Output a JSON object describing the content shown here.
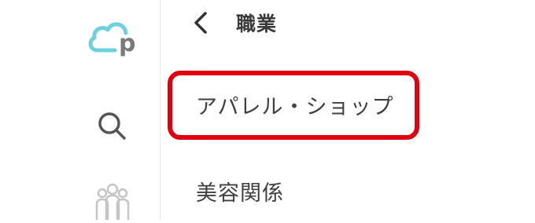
{
  "sidebar": {
    "logo_icon": "cloud-p-logo",
    "logo_letter": "p",
    "icons": [
      "search-icon",
      "people-icon"
    ]
  },
  "header": {
    "back_icon": "chevron-left-icon",
    "title": "職業"
  },
  "list": {
    "items": [
      {
        "label": "アパレル・ショップ"
      },
      {
        "label": "美容関係"
      }
    ]
  },
  "colors": {
    "logo_cloud": "#6ed0dc",
    "logo_letter": "#7a7a7a",
    "highlight": "#e00010",
    "text": "#3f3f3f"
  }
}
